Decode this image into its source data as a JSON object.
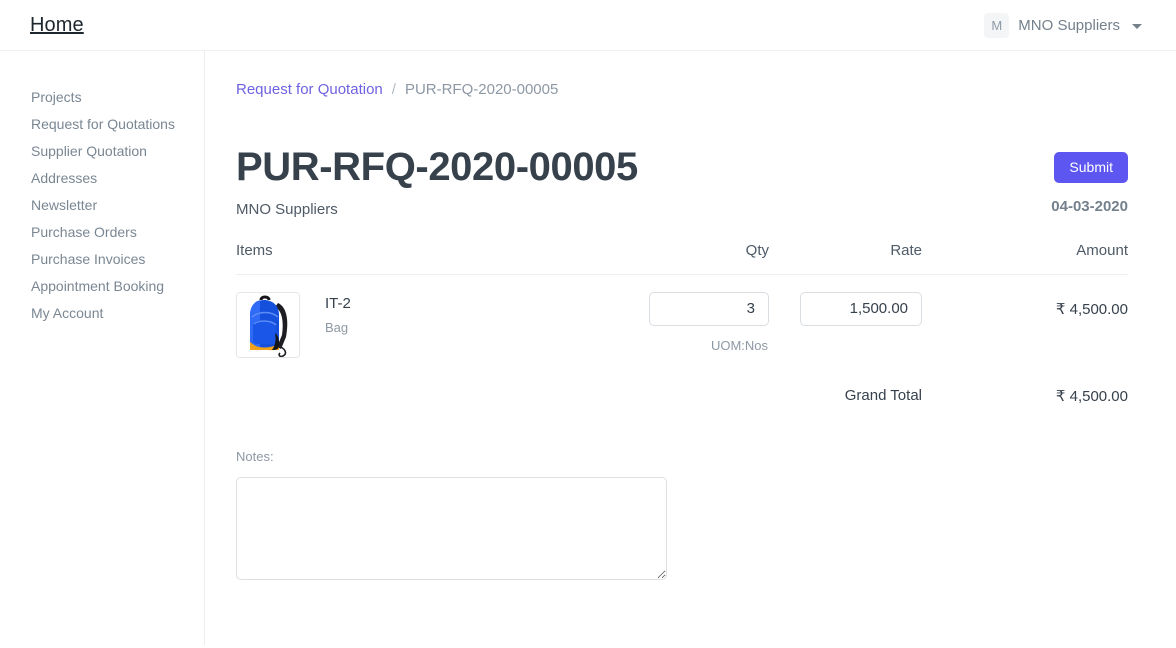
{
  "navbar": {
    "brand": "Home",
    "user_initial": "M",
    "user_name": "MNO Suppliers",
    "caret_icon": "chevron-down-icon"
  },
  "sidebar": {
    "items": [
      {
        "label": "Projects"
      },
      {
        "label": "Request for Quotations"
      },
      {
        "label": "Supplier Quotation"
      },
      {
        "label": "Addresses"
      },
      {
        "label": "Newsletter"
      },
      {
        "label": "Purchase Orders"
      },
      {
        "label": "Purchase Invoices"
      },
      {
        "label": "Appointment Booking"
      },
      {
        "label": "My Account"
      }
    ]
  },
  "breadcrumb": {
    "parent": "Request for Quotation",
    "separator": "/",
    "current": "PUR-RFQ-2020-00005"
  },
  "document": {
    "title": "PUR-RFQ-2020-00005",
    "subtitle": "MNO Suppliers",
    "submit_label": "Submit",
    "date": "04-03-2020"
  },
  "table": {
    "headers": {
      "items": "Items",
      "qty": "Qty",
      "rate": "Rate",
      "amount": "Amount"
    },
    "rows": [
      {
        "thumbnail_icon": "blue-backpack-image",
        "name": "IT-2",
        "description": "Bag",
        "qty": "3",
        "rate": "1,500.00",
        "uom": "UOM:Nos",
        "amount": "₹ 4,500.00"
      }
    ],
    "grand_total_label": "Grand Total",
    "grand_total_value": "₹ 4,500.00"
  },
  "notes": {
    "label": "Notes:",
    "value": "",
    "placeholder": ""
  },
  "colors": {
    "accent": "#5e56f0",
    "link": "#6e62e0",
    "text_dark": "#36414c",
    "text_muted": "#8d98a4",
    "border": "#e4e6e9"
  }
}
